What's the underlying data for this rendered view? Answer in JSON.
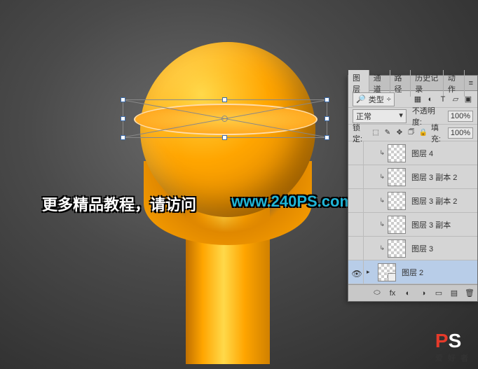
{
  "watermark": {
    "text": "更多精品教程，请访问",
    "url": "www.240PS.com"
  },
  "logo": {
    "p": "P",
    "s": "S",
    "sub": "爱 好 者"
  },
  "panel": {
    "tabs": [
      "图层",
      "通道",
      "路径",
      "历史记录",
      "动作"
    ],
    "activeTab": 0,
    "kindLabel": "类型",
    "blendMode": "正常",
    "opacityLabel": "不透明度:",
    "opacityValue": "100%",
    "lockLabel": "锁定:",
    "fillLabel": "填充:",
    "fillValue": "100%",
    "icons": {
      "menu": "≡",
      "dropdown": "÷",
      "pixel": "▦",
      "adjust": "◐",
      "type": "T",
      "shape": "▱",
      "smart": "▣",
      "lockTrans": "⬚",
      "lockPaint": "✎",
      "lockPos": "✥",
      "lockArt": "🗇",
      "lockAll": "🔒",
      "eye": "👁",
      "arrow": "▸",
      "link": "⬭",
      "fx": "fx",
      "mask": "◐",
      "adjustNew": "◑",
      "group": "▭",
      "newLayer": "▤",
      "trash": "🗑"
    },
    "layers": [
      {
        "name": "图层 4",
        "visible": false,
        "indent": true,
        "selected": false,
        "smart": false
      },
      {
        "name": "图层 3 副本 2",
        "visible": false,
        "indent": true,
        "selected": false,
        "smart": false
      },
      {
        "name": "图层 3 副本 2",
        "visible": false,
        "indent": true,
        "selected": false,
        "smart": false
      },
      {
        "name": "图层 3 副本",
        "visible": false,
        "indent": true,
        "selected": false,
        "smart": false
      },
      {
        "name": "图层 3",
        "visible": false,
        "indent": true,
        "selected": false,
        "smart": false
      },
      {
        "name": "图层 2",
        "visible": true,
        "indent": false,
        "selected": true,
        "smart": true
      }
    ]
  }
}
